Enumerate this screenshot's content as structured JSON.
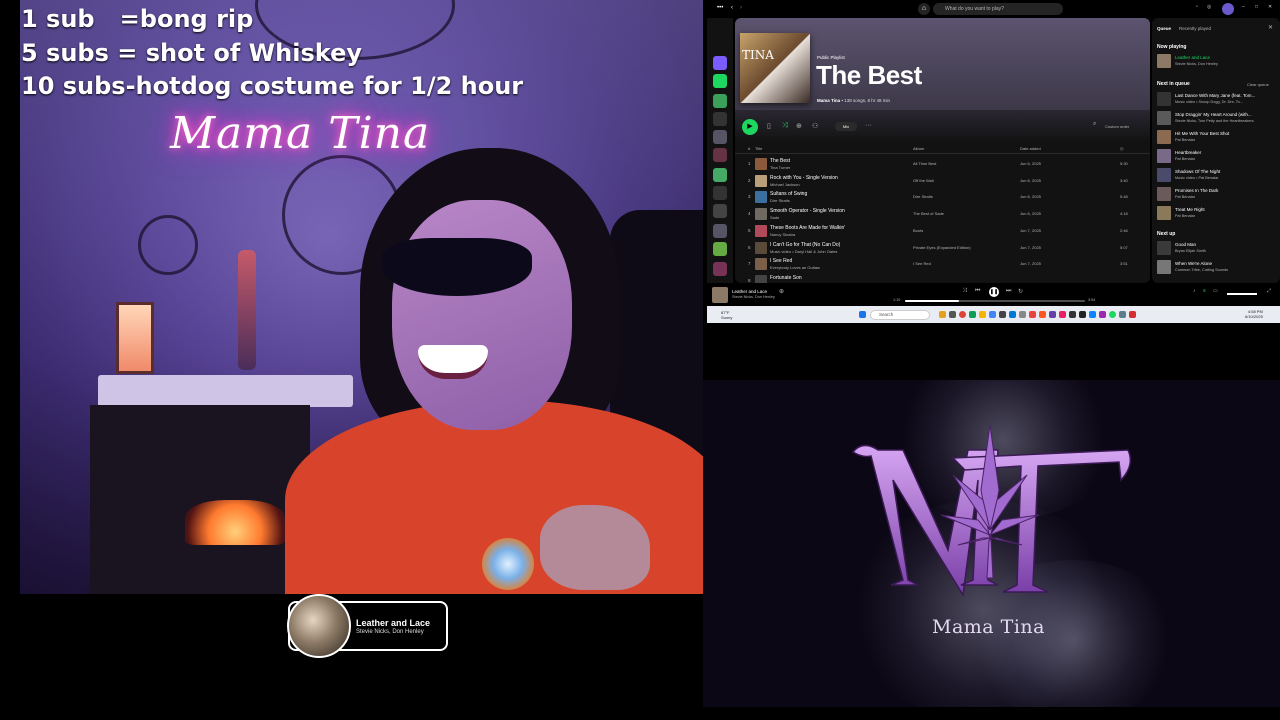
{
  "stream_overlay": {
    "lines": [
      "1 sub   =bong rip",
      "5 subs = shot of Whiskey",
      "10 subs-hotdog costume for 1/2 hour"
    ],
    "neon_sign": "Mama Tina"
  },
  "now_playing_widget": {
    "title": "Leather and Lace",
    "artist": "Stevie Nicks, Don Henley"
  },
  "spotify": {
    "top_bar": {
      "search_placeholder": "What do you want to play?",
      "nav_icons": [
        "more-icon",
        "back-icon",
        "forward-icon"
      ]
    },
    "playlist": {
      "type": "Public Playlist",
      "title": "The Best",
      "cover_text": "TINA",
      "owner": "Mama Tina",
      "meta": "• 138 songs, 8 hr 48 min",
      "mix_label": "Mix",
      "order_label": "Custom order"
    },
    "columns": {
      "num": "#",
      "title": "Title",
      "album": "Album",
      "date_added": "Date added"
    },
    "tracks": [
      {
        "num": "1",
        "title": "The Best",
        "artist": "Tina Turner",
        "album": "All Time Best",
        "date": "Jun 6, 2025",
        "duration": "5:30"
      },
      {
        "num": "2",
        "title": "Rock with You - Single Version",
        "artist": "Michael Jackson",
        "album": "Off the Wall",
        "date": "Jun 6, 2025",
        "duration": "3:40"
      },
      {
        "num": "3",
        "title": "Sultans of Swing",
        "artist": "Dire Straits",
        "album": "Dire Straits",
        "date": "Jun 6, 2025",
        "duration": "5:48"
      },
      {
        "num": "4",
        "title": "Smooth Operator - Single Version",
        "artist": "Sade",
        "album": "The Best of Sade",
        "date": "Jun 6, 2025",
        "duration": "4:18"
      },
      {
        "num": "5",
        "title": "These Boots Are Made for Walkin'",
        "artist": "Nancy Sinatra",
        "album": "Boots",
        "date": "Jun 7, 2025",
        "duration": "2:46"
      },
      {
        "num": "6",
        "title": "I Can't Go for That (No Can Do)",
        "artist": "Music video • Daryl Hall & John Oates",
        "album": "Private Eyes (Expanded Edition)",
        "date": "Jun 7, 2025",
        "duration": "5:07"
      },
      {
        "num": "7",
        "title": "I See Red",
        "artist": "Everybody Loves an Outlaw",
        "album": "I See Red",
        "date": "Jun 7, 2025",
        "duration": "3:51"
      },
      {
        "num": "8",
        "title": "Fortunate Son",
        "artist": "",
        "album": "",
        "date": "",
        "duration": ""
      }
    ],
    "queue": {
      "tabs": [
        "Queue",
        "Recently played"
      ],
      "now_playing_label": "Now playing",
      "now_playing": {
        "title": "Leather and Lace",
        "artist": "Stevie Nicks, Don Henley"
      },
      "next_in_queue_label": "Next in queue",
      "clear_label": "Clear queue",
      "next_in_queue": [
        {
          "title": "Last Dance With Mary Jane (feat. Tom...",
          "artist": "Music video • Snoop Dogg, Dr. Dre, To..."
        },
        {
          "title": "Stop Draggin' My Heart Around (with...",
          "artist": "Stevie Nicks, Tom Petty and the Heartbreakers"
        },
        {
          "title": "Hit Me With Your Best Shot",
          "artist": "Pat Benatar"
        },
        {
          "title": "Heartbreaker",
          "artist": "Pat Benatar"
        },
        {
          "title": "Shadows Of The Night",
          "artist": "Music video • Pat Benatar"
        },
        {
          "title": "Promises In The Dark",
          "artist": "Pat Benatar"
        },
        {
          "title": "Treat Me Right",
          "artist": "Pat Benatar"
        }
      ],
      "next_up_label": "Next up",
      "next_up": [
        {
          "title": "Good Man",
          "artist": "Bryan Elijah Smith"
        },
        {
          "title": "When We're Alone",
          "artist": "Common Tribe, Cutting Sounds"
        }
      ]
    },
    "player": {
      "title": "Leather and Lace",
      "artist": "Stevie Nicks, Don Henley",
      "elapsed": "1:10",
      "total": "3:54",
      "progress": 0.3
    },
    "taskbar": {
      "weather_temp": "87°F",
      "weather_desc": "Sunny",
      "search_label": "Search",
      "time": "4:58 PM",
      "date": "6/10/2025"
    },
    "colors": {
      "accent": "#1ed760",
      "panel": "#121212"
    }
  },
  "logo": {
    "text": "Mama Tina",
    "monogram": "MT",
    "colors": {
      "letters": "#b47ad9",
      "leaf": "#9a62c7"
    }
  }
}
